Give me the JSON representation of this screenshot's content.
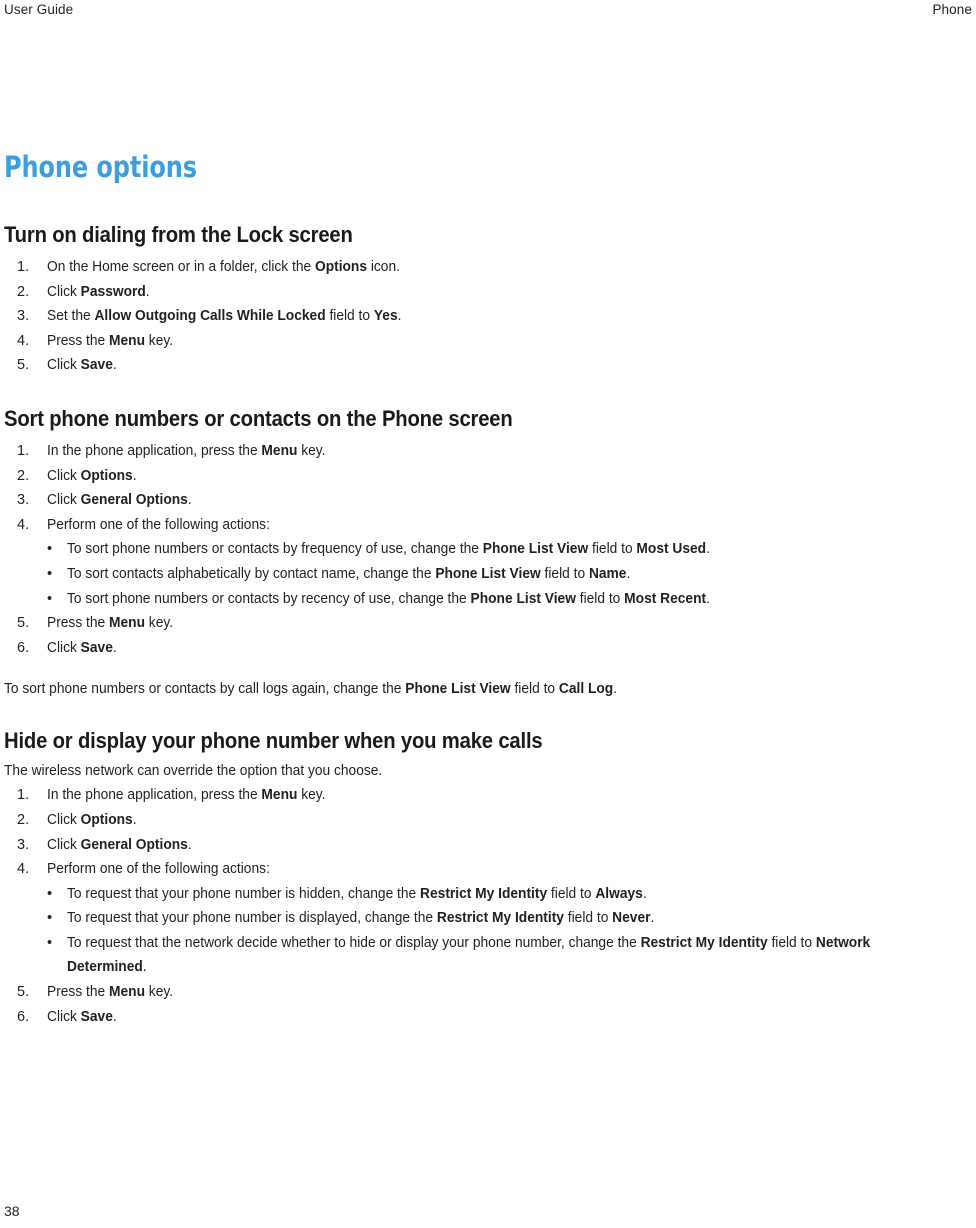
{
  "header": {
    "left": "User Guide",
    "right": "Phone"
  },
  "doc": {
    "title": "Phone options",
    "title_color": "#3b9fdf"
  },
  "sections": [
    {
      "heading": "Turn on dialing from the Lock screen",
      "steps": [
        {
          "num": "1.",
          "text": "On the Home screen or in a folder, click the <b>Options</b> icon."
        },
        {
          "num": "2.",
          "text": "Click <b>Password</b>."
        },
        {
          "num": "3.",
          "text": "Set the <b>Allow Outgoing Calls While Locked</b> field to <b>Yes</b>."
        },
        {
          "num": "4.",
          "text": "Press the <b>Menu</b> key."
        },
        {
          "num": "5.",
          "text": "Click <b>Save</b>."
        }
      ]
    },
    {
      "heading": "Sort phone numbers or contacts on the Phone screen",
      "steps": [
        {
          "num": "1.",
          "text": "In the phone application, press the <b>Menu</b> key."
        },
        {
          "num": "2.",
          "text": "Click <b>Options</b>."
        },
        {
          "num": "3.",
          "text": "Click <b>General Options</b>."
        },
        {
          "num": "4.",
          "text": "Perform one of the following actions:",
          "bullets": [
            "To sort phone numbers or contacts by frequency of use, change the <b>Phone List View</b> field to <b>Most Used</b>.",
            "To sort contacts alphabetically by contact name, change the <b>Phone List View</b> field to <b>Name</b>.",
            "To sort phone numbers or contacts by recency of use, change the <b>Phone List View</b> field to <b>Most Recent</b>."
          ]
        },
        {
          "num": "5.",
          "text": "Press the <b>Menu</b> key."
        },
        {
          "num": "6.",
          "text": "Click <b>Save</b>."
        }
      ],
      "trailing": "To sort phone numbers or contacts by call logs again, change the <b>Phone List View</b> field to <b>Call Log</b>."
    },
    {
      "heading": "Hide or display your phone number when you make calls",
      "lead": "The wireless network can override the option that you choose.",
      "steps": [
        {
          "num": "1.",
          "text": "In the phone application, press the <b>Menu</b> key."
        },
        {
          "num": "2.",
          "text": "Click <b>Options</b>."
        },
        {
          "num": "3.",
          "text": "Click <b>General Options</b>."
        },
        {
          "num": "4.",
          "text": "Perform one of the following actions:",
          "bullets": [
            "To request that your phone number is hidden, change the <b>Restrict My Identity</b> field to <b>Always</b>.",
            "To request that your phone number is displayed, change the <b>Restrict My Identity</b> field to <b>Never</b>.",
            "To request that the network decide whether to hide or display your phone number, change the <b>Restrict My Identity</b> field to <b>Network Determined</b>."
          ]
        },
        {
          "num": "5.",
          "text": "Press the <b>Menu</b> key."
        },
        {
          "num": "6.",
          "text": "Click <b>Save</b>."
        }
      ]
    }
  ],
  "footer": {
    "page_number": "38"
  },
  "bullet_glyph": "•"
}
